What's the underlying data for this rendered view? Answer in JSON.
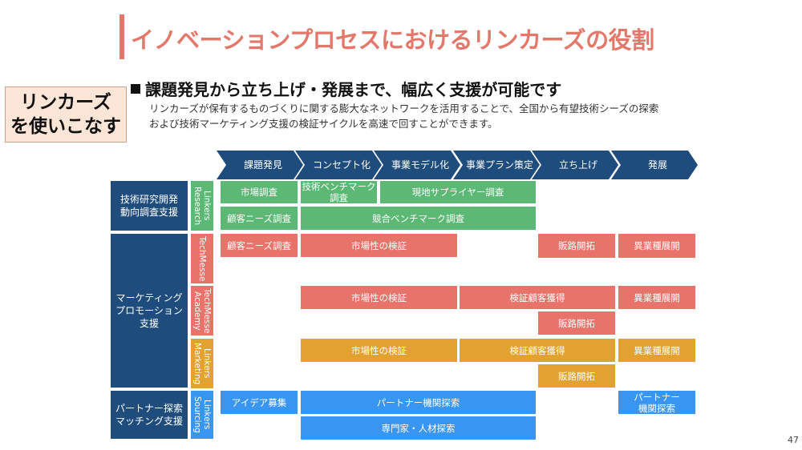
{
  "slide": {
    "title": "イノベーションプロセスにおけるリンカーズの役割",
    "callout": {
      "line1": "リンカーズ",
      "line2": "を使いこなす"
    },
    "headline": "課題発見から立ち上げ・発展まで、幅広く支援が可能です",
    "description": {
      "line1": "リンカーズが保有するものづくりに関する膨大なネットワークを活用することで、全国から有望技術シーズの探索",
      "line2": "および技術マーケティング支援の検証サイクルを高速で回すことができます。"
    },
    "page_number": "47"
  },
  "colors": {
    "title": "#e3786a",
    "navy": "#1e4c7c",
    "green": "#5cb875",
    "red": "#e8736a",
    "orange": "#e3a230",
    "blue": "#3996f0",
    "callout_bg": "#fbe5d6"
  },
  "stages": [
    "課題発見",
    "コンセプト化",
    "事業モデル化",
    "事業プラン策定",
    "立ち上げ",
    "発展"
  ],
  "categories": [
    {
      "label": "技術研究開発\n動向調査支援"
    },
    {
      "label": "マーケティング\nプロモーション\n支援"
    },
    {
      "label": "パートナー探索\nマッチング支援"
    }
  ],
  "services": [
    {
      "label": "Linkers\nResearch"
    },
    {
      "label": "TechMesse"
    },
    {
      "label": "TechMesse\nAcademy"
    },
    {
      "label": "Linkers\nMarketing"
    },
    {
      "label": "Linkers\nSourcing"
    }
  ],
  "blocks": {
    "research": [
      "市場調査",
      "技術ベンチマーク\n調査",
      "現地サプライヤー調査",
      "顧客ニーズ調査",
      "競合ベンチマーク調査"
    ],
    "techmesse": [
      "顧客ニーズ調査",
      "市場性の検証",
      "販路開拓",
      "異業種展開"
    ],
    "academy": [
      "市場性の検証",
      "検証顧客獲得",
      "異業種展開",
      "販路開拓"
    ],
    "marketing": [
      "市場性の検証",
      "検証顧客獲得",
      "異業種展開",
      "販路開拓"
    ],
    "sourcing": [
      "アイデア募集",
      "パートナー機関探索",
      "パートナー\n機関探索",
      "専門家・人材探索"
    ]
  }
}
